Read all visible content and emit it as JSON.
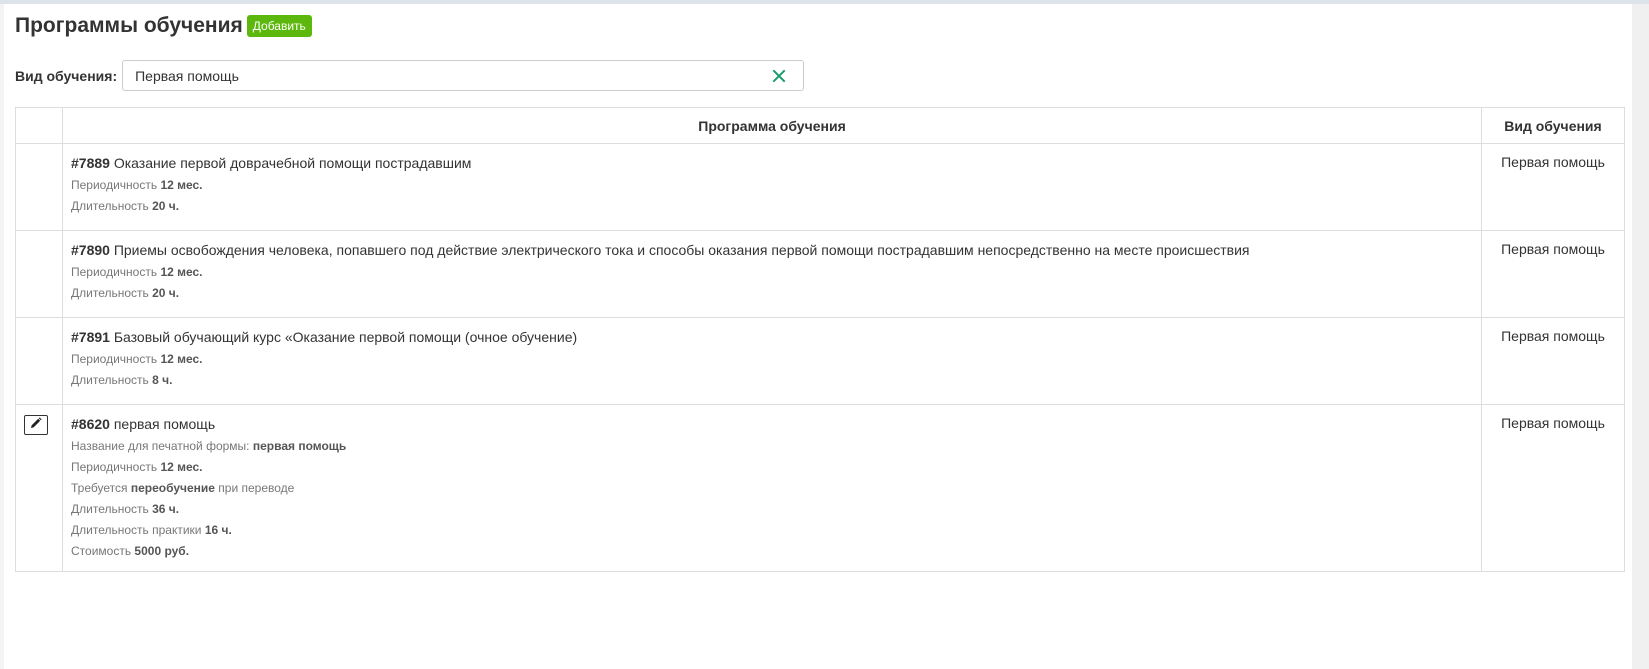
{
  "page": {
    "title": "Программы обучения",
    "add_label": "Добавить"
  },
  "filter": {
    "label": "Вид обучения:",
    "value": "Первая помощь",
    "clear_icon": "close-icon",
    "clear_color": "#1e9e6e"
  },
  "table": {
    "headers": {
      "program": "Программа обучения",
      "type": "Вид обучения"
    },
    "rows": [
      {
        "id": "#7889",
        "title": "Оказание первой доврачебной помощи пострадавшим",
        "type": "Первая помощь",
        "periodicity_label": "Периодичность",
        "periodicity_value": "12 мес.",
        "duration_label": "Длительность",
        "duration_value": "20 ч."
      },
      {
        "id": "#7890",
        "title": "Приемы освобождения человека, попавшего под действие электрического тока и способы оказания первой помощи пострадавшим непосредственно на месте происшествия",
        "type": "Первая помощь",
        "periodicity_label": "Периодичность",
        "periodicity_value": "12 мес.",
        "duration_label": "Длительность",
        "duration_value": "20 ч."
      },
      {
        "id": "#7891",
        "title": "Базовый обучающий курс «Оказание первой помощи (очное обучение)",
        "type": "Первая помощь",
        "periodicity_label": "Периодичность",
        "periodicity_value": "12 мес.",
        "duration_label": "Длительность",
        "duration_value": "8 ч."
      },
      {
        "id": "#8620",
        "title": "первая помощь",
        "type": "Первая помощь",
        "edit_icon": "pencil-icon",
        "print_name_label": "Название для печатной формы:",
        "print_name_value": "первая помощь",
        "periodicity_label": "Периодичность",
        "periodicity_value": "12 мес.",
        "retraining_prefix": "Требуется",
        "retraining_value": "переобучение",
        "retraining_suffix": "при переводе",
        "duration_label": "Длительность",
        "duration_value": "36 ч.",
        "practice_label": "Длительность практики",
        "practice_value": "16 ч.",
        "cost_label": "Стоимость",
        "cost_value": "5000 руб."
      }
    ]
  },
  "colors": {
    "accent_green": "#5cb80c",
    "border": "#dddddd"
  }
}
